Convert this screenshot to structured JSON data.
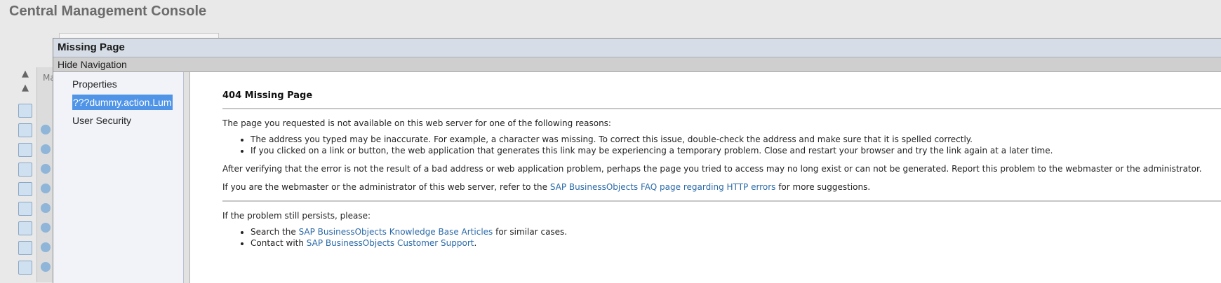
{
  "app": {
    "title": "Central Management Console"
  },
  "background": {
    "partial_label": "Ma"
  },
  "dialog": {
    "title": "Missing Page",
    "nav_toggle_label": "Hide Navigation",
    "sidebar": {
      "items": [
        {
          "label": "Properties",
          "selected": false
        },
        {
          "label": "???dummy.action.Lum",
          "selected": true
        },
        {
          "label": "User Security",
          "selected": false
        }
      ]
    },
    "content": {
      "heading": "404 Missing Page",
      "intro": "The page you requested is not available on this web server for one of the following reasons:",
      "reasons": [
        "The address you typed may be inaccurate. For example, a character was missing. To correct this issue, double-check the address and make sure that it is spelled correctly.",
        "If you clicked on a link or button, the web application that generates this link may be experiencing a temporary problem. Close and restart your browser and try the link again at a later time."
      ],
      "after_verify": "After verifying that the error is not the result of a bad address or web application problem, perhaps the page you tried to access may no long exist or can not be generated. Report this problem to the webmaster or the administrator.",
      "admin_prefix": "If you are the webmaster or the administrator of this web server, refer to the ",
      "faq_link": "SAP BusinessObjects FAQ page regarding HTTP errors",
      "admin_suffix": " for more suggestions.",
      "persist": "If the problem still persists, please:",
      "search_prefix": "Search the ",
      "kb_link": "SAP BusinessObjects Knowledge Base Articles",
      "search_suffix": " for similar cases.",
      "contact_prefix": "Contact with ",
      "support_link": "SAP BusinessObjects Customer Support",
      "contact_suffix": "."
    }
  }
}
